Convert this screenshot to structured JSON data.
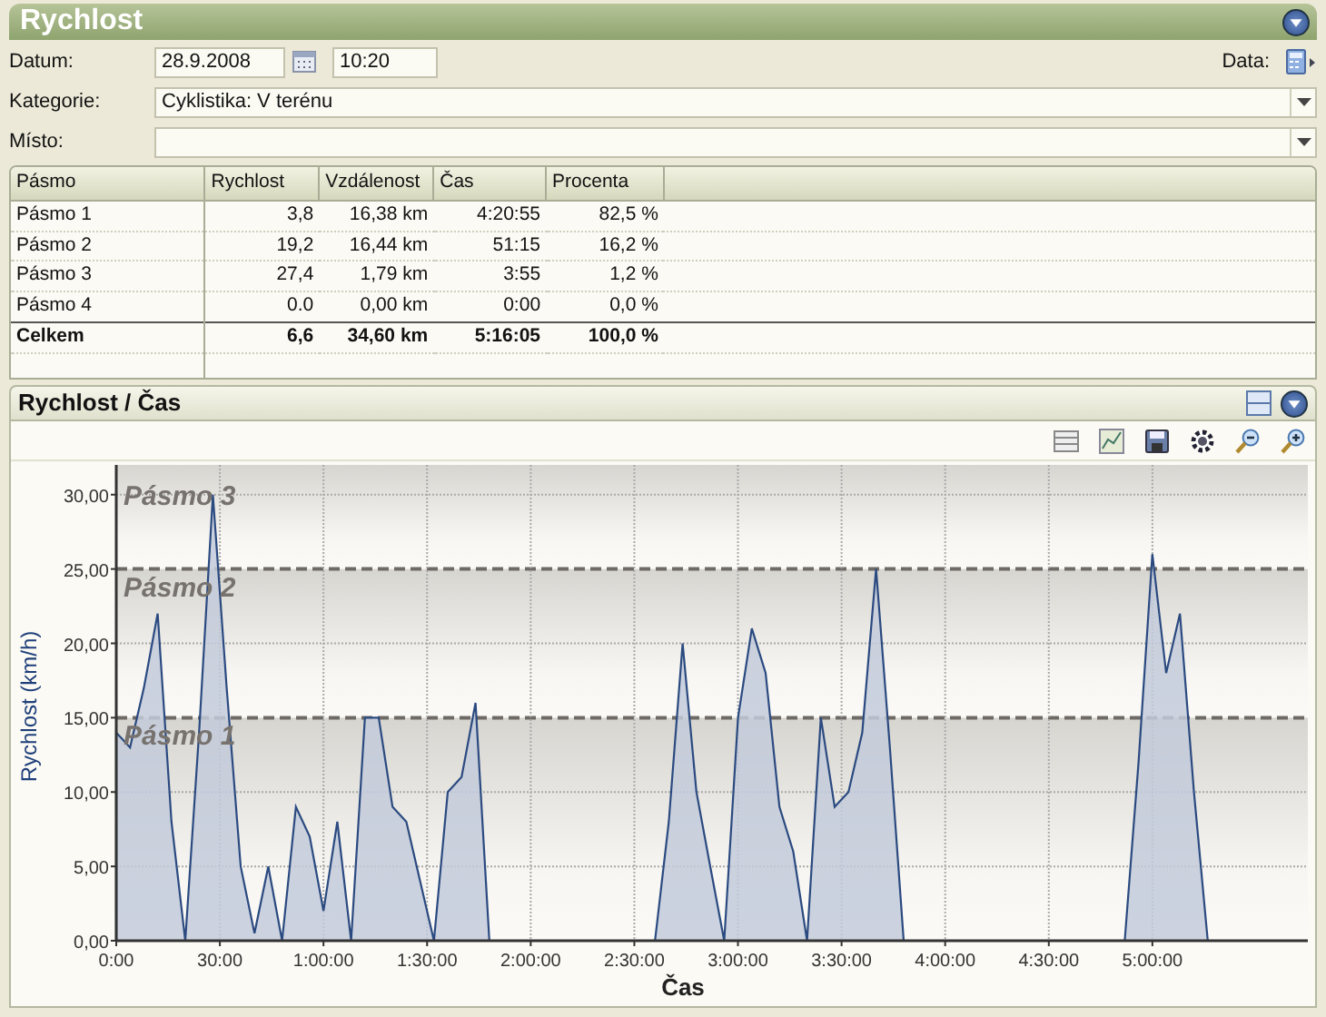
{
  "panel": {
    "title": "Rychlost"
  },
  "form": {
    "date_label": "Datum:",
    "date": "28.9.2008",
    "time": "10:20",
    "data_label": "Data:",
    "category_label": "Kategorie:",
    "category": "Cyklistika: V terénu",
    "place_label": "Místo:"
  },
  "table": {
    "columns": [
      "Pásmo",
      "Rychlost",
      "Vzdálenost",
      "Čas",
      "Procenta"
    ],
    "rows": [
      {
        "kind": "zone",
        "cells": [
          "Pásmo 1",
          "3,8",
          "16,38 km",
          "4:20:55",
          "82,5 %"
        ]
      },
      {
        "kind": "zone",
        "cells": [
          "Pásmo 2",
          "19,2",
          "16,44 km",
          "51:15",
          "16,2 %"
        ]
      },
      {
        "kind": "zone",
        "cells": [
          "Pásmo 3",
          "27,4",
          "1,79 km",
          "3:55",
          "1,2 %"
        ]
      },
      {
        "kind": "zone",
        "cells": [
          "Pásmo 4",
          "0.0",
          "0,00 km",
          "0:00",
          "0,0 %"
        ]
      },
      {
        "kind": "total",
        "cells": [
          "Celkem",
          "6,6",
          "34,60 km",
          "5:16:05",
          "100,0 %"
        ]
      }
    ]
  },
  "chart_panel": {
    "title": "Rychlost / Čas",
    "chart_data": {
      "type": "area",
      "xlabel": "Čas",
      "ylabel": "Rychlost (km/h)",
      "x": [
        0,
        4,
        8,
        12,
        16,
        20,
        24,
        28,
        32,
        36,
        40,
        44,
        48,
        52,
        56,
        60,
        64,
        68,
        72,
        76,
        80,
        84,
        88,
        92,
        96,
        100,
        104,
        108,
        112,
        116,
        120,
        124,
        128,
        132,
        136,
        140,
        144,
        148,
        152,
        156,
        160,
        164,
        168,
        172,
        176,
        180,
        184,
        188,
        192,
        196,
        200,
        204,
        208,
        212,
        216,
        220,
        224,
        228,
        232,
        236,
        240,
        244,
        248,
        252,
        256,
        260,
        264,
        268,
        272,
        276,
        280,
        284,
        288,
        292,
        296,
        300,
        304,
        308,
        312,
        316
      ],
      "series": [
        {
          "color": "#2b4a80",
          "values": [
            14,
            13,
            17,
            22,
            8,
            0,
            14,
            30,
            17,
            5,
            0.5,
            5,
            0,
            9,
            7,
            2,
            8,
            0,
            15,
            15,
            9,
            8,
            4,
            0,
            10,
            11,
            16,
            0,
            0,
            0,
            0,
            0,
            0,
            0,
            0,
            0,
            0,
            0,
            0,
            0,
            8,
            20,
            10,
            5,
            0,
            15,
            21,
            18,
            9,
            6,
            0,
            15,
            9,
            10,
            14,
            25,
            13,
            0,
            0,
            0,
            0,
            0,
            0,
            0,
            0,
            0,
            0,
            0,
            0,
            0,
            0,
            0,
            0,
            0,
            12,
            26,
            18,
            22,
            10,
            0
          ]
        }
      ],
      "xlim": [
        0,
        345
      ],
      "ylim": [
        0,
        32
      ],
      "xticks": [
        {
          "value": 0,
          "label": "0:00"
        },
        {
          "value": 30,
          "label": "30:00"
        },
        {
          "value": 60,
          "label": "1:00:00"
        },
        {
          "value": 90,
          "label": "1:30:00"
        },
        {
          "value": 120,
          "label": "2:00:00"
        },
        {
          "value": 150,
          "label": "2:30:00"
        },
        {
          "value": 180,
          "label": "3:00:00"
        },
        {
          "value": 210,
          "label": "3:30:00"
        },
        {
          "value": 240,
          "label": "4:00:00"
        },
        {
          "value": 270,
          "label": "4:30:00"
        },
        {
          "value": 300,
          "label": "5:00:00"
        }
      ],
      "yticks": [
        {
          "value": 0,
          "label": "0,00"
        },
        {
          "value": 5,
          "label": "5,00"
        },
        {
          "value": 10,
          "label": "10,00"
        },
        {
          "value": 15,
          "label": "15,00"
        },
        {
          "value": 20,
          "label": "20,00"
        },
        {
          "value": 25,
          "label": "25,00"
        },
        {
          "value": 30,
          "label": "30,00"
        }
      ],
      "grid": true,
      "bands": [
        {
          "axis": "y",
          "from": 25,
          "to": 32,
          "label": "Pásmo 3"
        },
        {
          "axis": "y",
          "from": 15,
          "to": 25,
          "label": "Pásmo 2"
        },
        {
          "axis": "y",
          "from": 0,
          "to": 15,
          "label": "Pásmo 1"
        }
      ]
    }
  }
}
